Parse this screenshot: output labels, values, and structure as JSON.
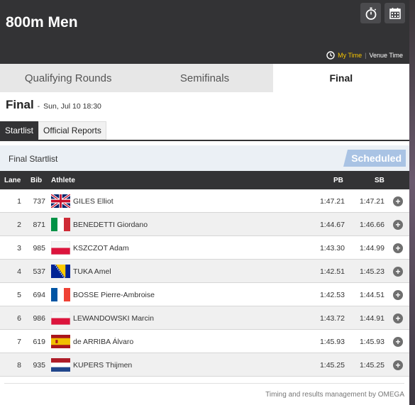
{
  "header": {
    "title": "800m Men",
    "icons": [
      "stopwatch-icon",
      "calendar-icon"
    ],
    "time_options": {
      "my_time": "My Time",
      "venue_time": "Venue Time"
    }
  },
  "round_tabs": [
    "Qualifying Rounds",
    "Semifinals",
    "Final"
  ],
  "active_round": "Final",
  "round": {
    "title": "Final",
    "dash": "-",
    "datetime": "Sun, Jul 10 18:30"
  },
  "sub_tabs": [
    "Startlist",
    "Official Reports"
  ],
  "startlist": {
    "title": "Final Startlist",
    "status": "Scheduled"
  },
  "table": {
    "headers": {
      "lane": "Lane",
      "bib": "Bib",
      "athlete": "Athlete",
      "pb": "PB",
      "sb": "SB"
    },
    "rows": [
      {
        "lane": "1",
        "bib": "737",
        "country": "GBR",
        "athlete": "GILES Elliot",
        "pb": "1:47.21",
        "sb": "1:47.21"
      },
      {
        "lane": "2",
        "bib": "871",
        "country": "ITA",
        "athlete": "BENEDETTI Giordano",
        "pb": "1:44.67",
        "sb": "1:46.66"
      },
      {
        "lane": "3",
        "bib": "985",
        "country": "POL",
        "athlete": "KSZCZOT Adam",
        "pb": "1:43.30",
        "sb": "1:44.99"
      },
      {
        "lane": "4",
        "bib": "537",
        "country": "BIH",
        "athlete": "TUKA Amel",
        "pb": "1:42.51",
        "sb": "1:45.23"
      },
      {
        "lane": "5",
        "bib": "694",
        "country": "FRA",
        "athlete": "BOSSE Pierre-Ambroise",
        "pb": "1:42.53",
        "sb": "1:44.51"
      },
      {
        "lane": "6",
        "bib": "986",
        "country": "POL",
        "athlete": "LEWANDOWSKI Marcin",
        "pb": "1:43.72",
        "sb": "1:44.91"
      },
      {
        "lane": "7",
        "bib": "619",
        "country": "ESP",
        "athlete": "de ARRIBA Álvaro",
        "pb": "1:45.93",
        "sb": "1:45.93"
      },
      {
        "lane": "8",
        "bib": "935",
        "country": "NED",
        "athlete": "KUPERS Thijmen",
        "pb": "1:45.25",
        "sb": "1:45.25"
      }
    ]
  },
  "footer": {
    "credits": "Timing and results management by OMEGA"
  },
  "colors": {
    "header_bg": "#333335",
    "my_time": "#f6c400",
    "status_badge": "#a9c3e4"
  }
}
